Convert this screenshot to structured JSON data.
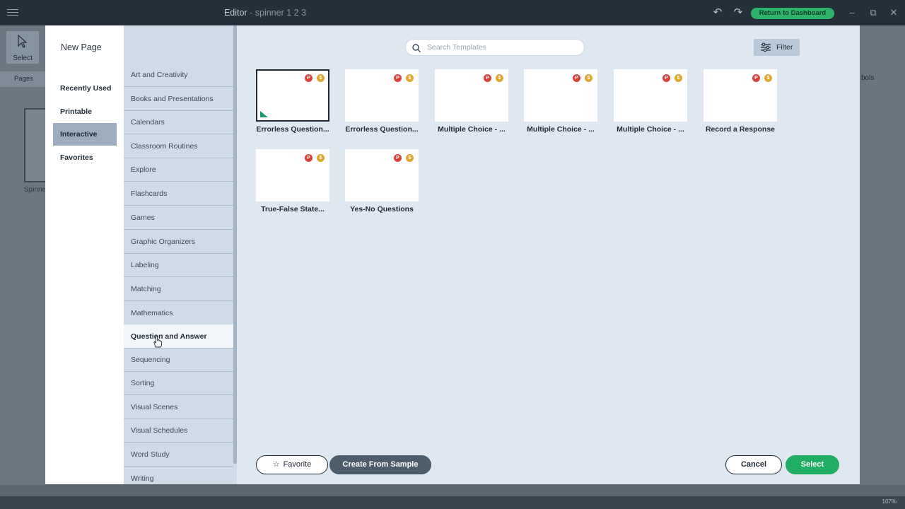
{
  "window": {
    "title": "Editor",
    "subtitle": "- spinner 1 2 3",
    "return_button": "Return to Dashboard"
  },
  "editor": {
    "select_tool": "Select",
    "pages_tab": "Pages",
    "page_name": "Spinne",
    "right_tab": "bols",
    "zoom": "107%"
  },
  "modal": {
    "heading": "New Page",
    "nav": [
      {
        "label": "Recently Used",
        "active": false
      },
      {
        "label": "Printable",
        "active": false
      },
      {
        "label": "Interactive",
        "active": true
      },
      {
        "label": "Favorites",
        "active": false
      }
    ],
    "categories": [
      {
        "label": "Art and Creativity"
      },
      {
        "label": "Books and Presentations"
      },
      {
        "label": "Calendars"
      },
      {
        "label": "Classroom Routines"
      },
      {
        "label": "Explore"
      },
      {
        "label": "Flashcards"
      },
      {
        "label": "Games"
      },
      {
        "label": "Graphic Organizers"
      },
      {
        "label": "Labeling"
      },
      {
        "label": "Matching"
      },
      {
        "label": "Mathematics"
      },
      {
        "label": "Question and Answer",
        "active": true
      },
      {
        "label": "Sequencing"
      },
      {
        "label": "Sorting"
      },
      {
        "label": "Visual Scenes"
      },
      {
        "label": "Visual Schedules"
      },
      {
        "label": "Word Study"
      },
      {
        "label": "Writing"
      }
    ],
    "search": {
      "placeholder": "Search Templates",
      "value": ""
    },
    "filter_label": "Filter",
    "badges": {
      "p": "P",
      "s": "$"
    },
    "templates": [
      {
        "name": "Errorless Question...",
        "selected": true
      },
      {
        "name": "Errorless Question..."
      },
      {
        "name": "Multiple Choice - ..."
      },
      {
        "name": "Multiple Choice - ..."
      },
      {
        "name": "Multiple Choice - ..."
      },
      {
        "name": "Record a Response"
      },
      {
        "name": "True-False State..."
      },
      {
        "name": "Yes-No Questions"
      }
    ],
    "buttons": {
      "favorite": "Favorite",
      "create_from_sample": "Create From Sample",
      "cancel": "Cancel",
      "select": "Select"
    }
  },
  "colors": {
    "accent_green": "#1fae64",
    "selected_nav": "#9badbf",
    "category_bg": "#cfdbe7",
    "content_bg": "#dfe8f1",
    "badge_p": "#d9423c",
    "badge_s": "#e0a72e"
  }
}
